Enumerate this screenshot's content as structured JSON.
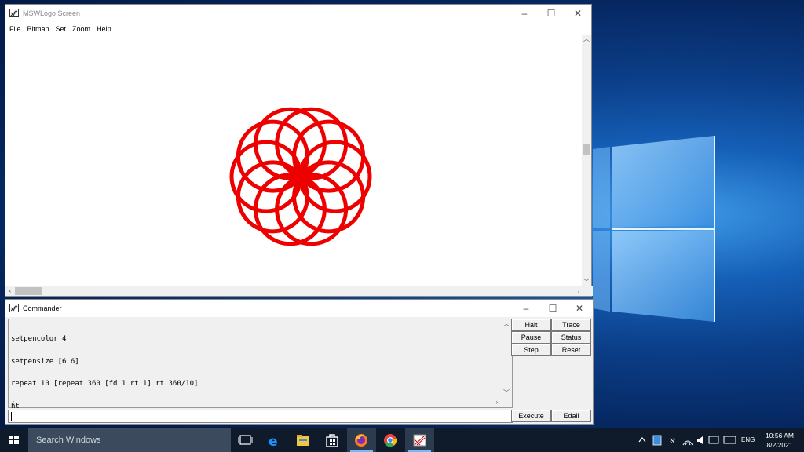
{
  "colors": {
    "pen": "#ee0000",
    "accent": "#0078d7",
    "taskbar": "#0f1b2a"
  },
  "logo_window": {
    "title": "MSWLogo Screen",
    "menu": [
      "File",
      "Bitmap",
      "Set",
      "Zoom",
      "Help"
    ],
    "drawing": {
      "description_icon": "rosette-drawing",
      "circles": 10
    }
  },
  "commander": {
    "title": "Commander",
    "history": [
      "setpencolor 4",
      "setpensize [6 6]",
      "repeat 10 [repeat 360 [fd 1 rt 1] rt 360/10]",
      "ht"
    ],
    "input_value": "",
    "buttons": {
      "halt": "Halt",
      "trace": "Trace",
      "pause": "Pause",
      "status": "Status",
      "step": "Step",
      "reset": "Reset",
      "execute": "Execute",
      "edall": "Edall"
    }
  },
  "taskbar": {
    "search_placeholder": "Search Windows",
    "language": "ENG",
    "time": "10:56 AM",
    "date": "8/2/2021",
    "apps": [
      "task-view-icon",
      "edge-icon",
      "file-explorer-icon",
      "store-icon",
      "firefox-icon",
      "chrome-icon",
      "mswlogo-icon"
    ]
  }
}
